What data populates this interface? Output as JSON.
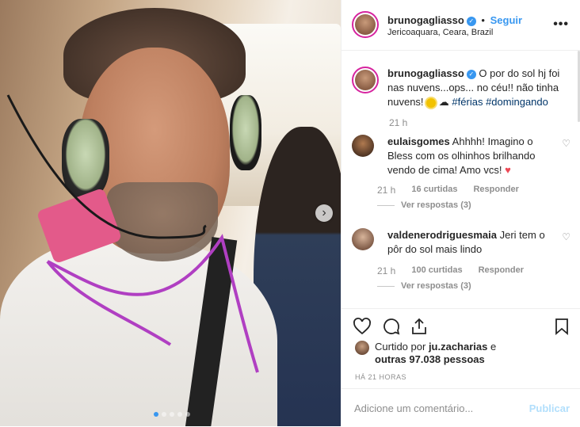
{
  "header": {
    "username": "brunogagliasso",
    "follow_label": "Seguir",
    "location": "Jericoaquara, Ceara, Brazil",
    "more_label": "•••"
  },
  "caption": {
    "username": "brunogagliasso",
    "text": "O por do sol hj foi nas nuvens...ops... no céu!! não tinha nuvens!",
    "hashtags": [
      "#férias",
      "#domingando"
    ],
    "time": "21 h"
  },
  "comments": [
    {
      "username": "eulaisgomes",
      "text": "Ahhhh! Imagino o Bless com os olhinhos brilhando vendo de cima! Amo vcs!",
      "time": "21 h",
      "likes": "16 curtidas",
      "reply_label": "Responder",
      "see_replies": "Ver respostas (3)"
    },
    {
      "username": "valdenerodriguesmaia",
      "text": "Jeri tem o pôr do sol mais lindo",
      "time": "21 h",
      "likes": "100 curtidas",
      "reply_label": "Responder",
      "see_replies": "Ver respostas (3)"
    }
  ],
  "likes": {
    "prefix": "Curtido por",
    "user": "ju.zacharias",
    "middle": "e",
    "others": "outras 97.038 pessoas"
  },
  "posted_ago": "HÁ 21 HORAS",
  "add_comment": {
    "placeholder": "Adicione um comentário...",
    "post_label": "Publicar"
  },
  "icons": {
    "like": "heart-icon",
    "comment": "comment-icon",
    "share": "share-icon",
    "save": "bookmark-icon",
    "next": "chevron-right-icon"
  },
  "colors": {
    "link": "#3897f0",
    "hashtag": "#003569",
    "muted": "#8e8e8e",
    "heart": "#ed4956"
  }
}
